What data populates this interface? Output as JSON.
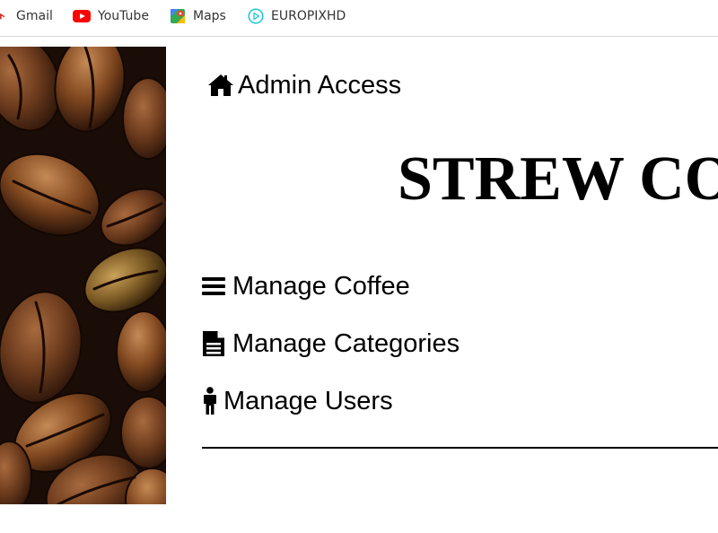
{
  "bookmarks": [
    {
      "label": "Gmail",
      "icon": "gmail-icon"
    },
    {
      "label": "YouTube",
      "icon": "youtube-icon"
    },
    {
      "label": "Maps",
      "icon": "maps-icon"
    },
    {
      "label": "EUROPIXHD",
      "icon": "play-circle-icon"
    }
  ],
  "header": {
    "admin_label": "Admin Access",
    "admin_icon": "home-icon"
  },
  "brand": {
    "title": "STREW CO"
  },
  "menu": [
    {
      "label": "Manage Coffee",
      "icon": "bars-icon"
    },
    {
      "label": "Manage Categories",
      "icon": "document-icon"
    },
    {
      "label": "Manage Users",
      "icon": "person-icon"
    }
  ],
  "colors": {
    "text": "#000000",
    "youtube_red": "#ff0000",
    "cyan": "#1bc6d9"
  }
}
